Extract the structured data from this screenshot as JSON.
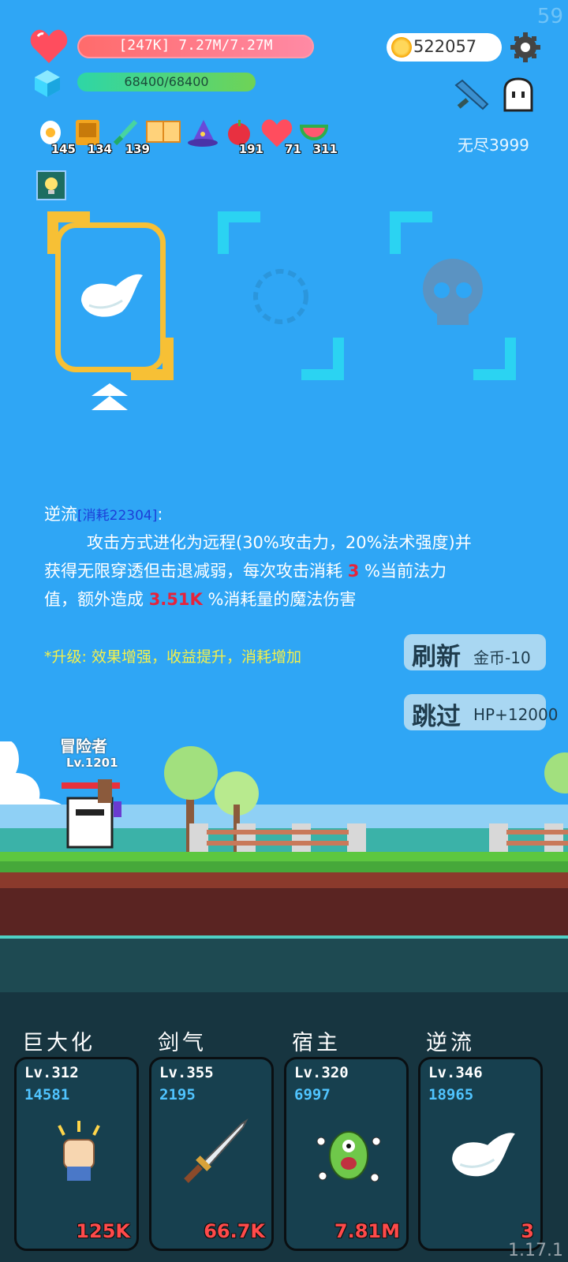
{
  "fps": "59",
  "version": "1.17.1",
  "hp_text": "[247K] 7.27M/7.27M",
  "mp_text": "68400/68400",
  "coins": "522057",
  "endless": "无尽3999",
  "items": [
    {
      "icon": "egg-icon",
      "count": "145"
    },
    {
      "icon": "book-icon",
      "count": "134"
    },
    {
      "icon": "wand-icon",
      "count": "139"
    },
    {
      "icon": "scroll-icon",
      "count": ""
    },
    {
      "icon": "wizard-hat-icon",
      "count": ""
    },
    {
      "icon": "apple-icon",
      "count": "191"
    },
    {
      "icon": "heart-icon",
      "count": "71"
    },
    {
      "icon": "watermelon-icon",
      "count": "311"
    }
  ],
  "description": {
    "name": "逆流",
    "cost": "[消耗22304]",
    "colon": ":",
    "line1": "攻击方式进化为远程(30%攻击力，20%法术强度)并",
    "line2a": "获得无限穿透但击退减弱，每次攻击消耗",
    "line2_value": "3",
    "line2b": "%当前法力",
    "line3a": "值，额外造成",
    "line3_value": "3.51K",
    "line3b": "%消耗量的魔法伤害",
    "upgrade": "*升级: 效果增强，收益提升，消耗增加"
  },
  "refresh_btn": {
    "label": "刷新",
    "cost": "金币-10"
  },
  "skip_btn": {
    "label": "跳过",
    "reward": "HP+12000"
  },
  "player": {
    "name": "冒险者",
    "level": "Lv.1201"
  },
  "skills": [
    {
      "title": "巨大化",
      "level": "Lv.312",
      "number": "14581",
      "value": "125K",
      "icon": "fist-icon"
    },
    {
      "title": "剑气",
      "level": "Lv.355",
      "number": "2195",
      "value": "66.7K",
      "icon": "sword-icon"
    },
    {
      "title": "宿主",
      "level": "Lv.320",
      "number": "6997",
      "value": "7.81M",
      "icon": "monster-icon"
    },
    {
      "title": "逆流",
      "level": "Lv.346",
      "number": "18965",
      "value": "3",
      "icon": "wing-icon"
    }
  ]
}
